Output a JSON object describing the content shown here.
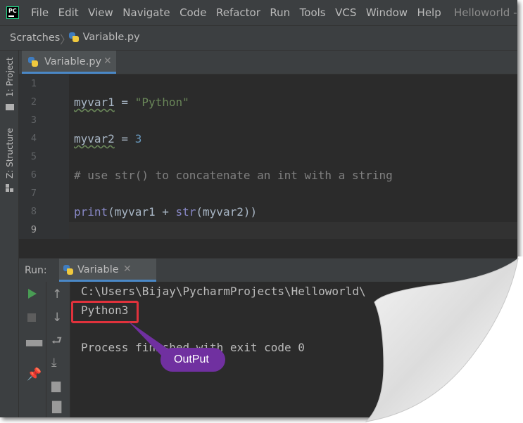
{
  "app": {
    "logo_text": "PC",
    "window_title": "Helloworld -"
  },
  "menu": [
    "File",
    "Edit",
    "View",
    "Navigate",
    "Code",
    "Refactor",
    "Run",
    "Tools",
    "VCS",
    "Window",
    "Help"
  ],
  "breadcrumb": {
    "root": "Scratches",
    "file": "Variable.py"
  },
  "side_tools": {
    "project": "1: Project",
    "structure": "Z: Structure"
  },
  "editor": {
    "tab_label": "Variable.py",
    "line_numbers": [
      "1",
      "2",
      "3",
      "4",
      "5",
      "6",
      "7",
      "8",
      "9"
    ],
    "current_line": "9",
    "lines": {
      "l2_var": "myvar1",
      "l2_op": " = ",
      "l2_str": "\"Python\"",
      "l4_var": "myvar2",
      "l4_op": " = ",
      "l4_num": "3",
      "l6_comment": "# use str() to concatenate an int with a string",
      "l8_print": "print",
      "l8_a": "(myvar1 + ",
      "l8_str": "str",
      "l8_b": "(myvar2))"
    }
  },
  "run": {
    "label": "Run:",
    "tab_label": "Variable",
    "console": {
      "path": "C:\\Users\\Bijay\\PycharmProjects\\Helloworld\\",
      "output": "Python3",
      "exit": "Process finished with exit code 0"
    }
  },
  "annotation": {
    "callout": "OutPut",
    "highlight_color": "#e0323c",
    "callout_color": "#7030a0"
  },
  "colors": {
    "ide_bg": "#3c3f41",
    "editor_bg": "#2b2b2b",
    "string": "#6a8759",
    "number": "#6897bb",
    "comment": "#808080",
    "builtin": "#8888c6",
    "accent": "#4a88c7"
  },
  "icons": [
    "python-file-icon",
    "play-icon",
    "stop-icon",
    "arrow-up-icon",
    "arrow-down-icon",
    "soft-wrap-icon",
    "scroll-to-end-icon",
    "print-icon",
    "trash-icon",
    "layout-icon",
    "pin-icon",
    "folder-icon",
    "structure-icon"
  ]
}
